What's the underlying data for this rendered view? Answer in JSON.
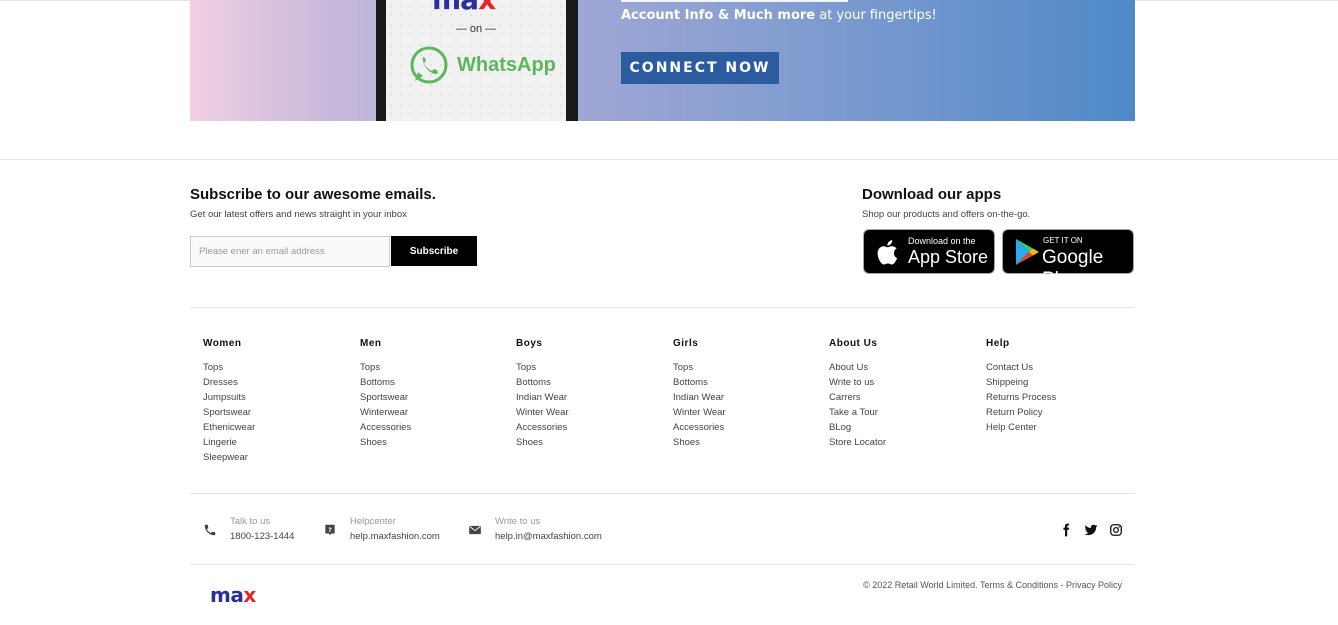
{
  "banner": {
    "brand_text": "ma",
    "brand_x": "x",
    "on_text": "— on —",
    "whatsapp_text": "WhatsApp",
    "tagline_bold": "Account Info & Much more",
    "tagline_rest": " at your fingertips!",
    "cta_label": "CONNECT NOW",
    "colors": {
      "cta_bg": "#2b5c9f",
      "whatsapp_green": "#5cb85c"
    }
  },
  "subscribe": {
    "title": "Subscribe to our awesome emails.",
    "description": "Get our latest offers and news straight in your inbox",
    "email_placeholder": "Please ener an email address",
    "button_label": "Subscribe"
  },
  "apps": {
    "title": "Download our apps",
    "description": "Shop our products and offers on-the-go.",
    "apple_small": "Download on the",
    "apple_big": "App Store",
    "google_small": "GET IT ON",
    "google_big": "Google Play"
  },
  "footer_columns": [
    {
      "title": "Women",
      "links": [
        "Tops",
        "Dresses",
        "Jumpsuits",
        "Sportswear",
        "Ethenicwear",
        "Lingerie",
        "Sleepwear"
      ]
    },
    {
      "title": "Men",
      "links": [
        "Tops",
        "Bottoms",
        "Sportswear",
        "Winterwear",
        "Accessories",
        "Shoes"
      ]
    },
    {
      "title": "Boys",
      "links": [
        "Tops",
        "Bottoms",
        "Indian Wear",
        "Winter Wear",
        "Accessories",
        "Shoes"
      ]
    },
    {
      "title": "Girls",
      "links": [
        "Tops",
        "Bottoms",
        "Indian Wear",
        "Winter Wear",
        "Accessories",
        "Shoes"
      ]
    },
    {
      "title": "About Us",
      "links": [
        "About Us",
        "Write to us",
        "Carrers",
        "Take a Tour",
        "BLog",
        "Store Locator"
      ]
    },
    {
      "title": "Help",
      "links": [
        "Contact Us",
        "Shippeing",
        "Returns Process",
        "Return Policy",
        "Help Center"
      ]
    }
  ],
  "contact": {
    "phone": {
      "label": "Talk to us",
      "value": "1800-123-1444",
      "icon": "phone-icon"
    },
    "helpcenter": {
      "label": "Helpcenter",
      "value": "help.maxfashion.com",
      "icon": "help-icon"
    },
    "email": {
      "label": "Write to us",
      "value": "help.in@maxfashion.com",
      "icon": "mail-icon"
    }
  },
  "social": [
    "facebook-icon",
    "twitter-icon",
    "instagram-icon"
  ],
  "bottom": {
    "logo_text": "ma",
    "logo_x": "x",
    "copyright": "© 2022 Retail World Limited.",
    "terms": "Terms & Conditions",
    "separator": " - ",
    "privacy": "Privacy Policy"
  }
}
